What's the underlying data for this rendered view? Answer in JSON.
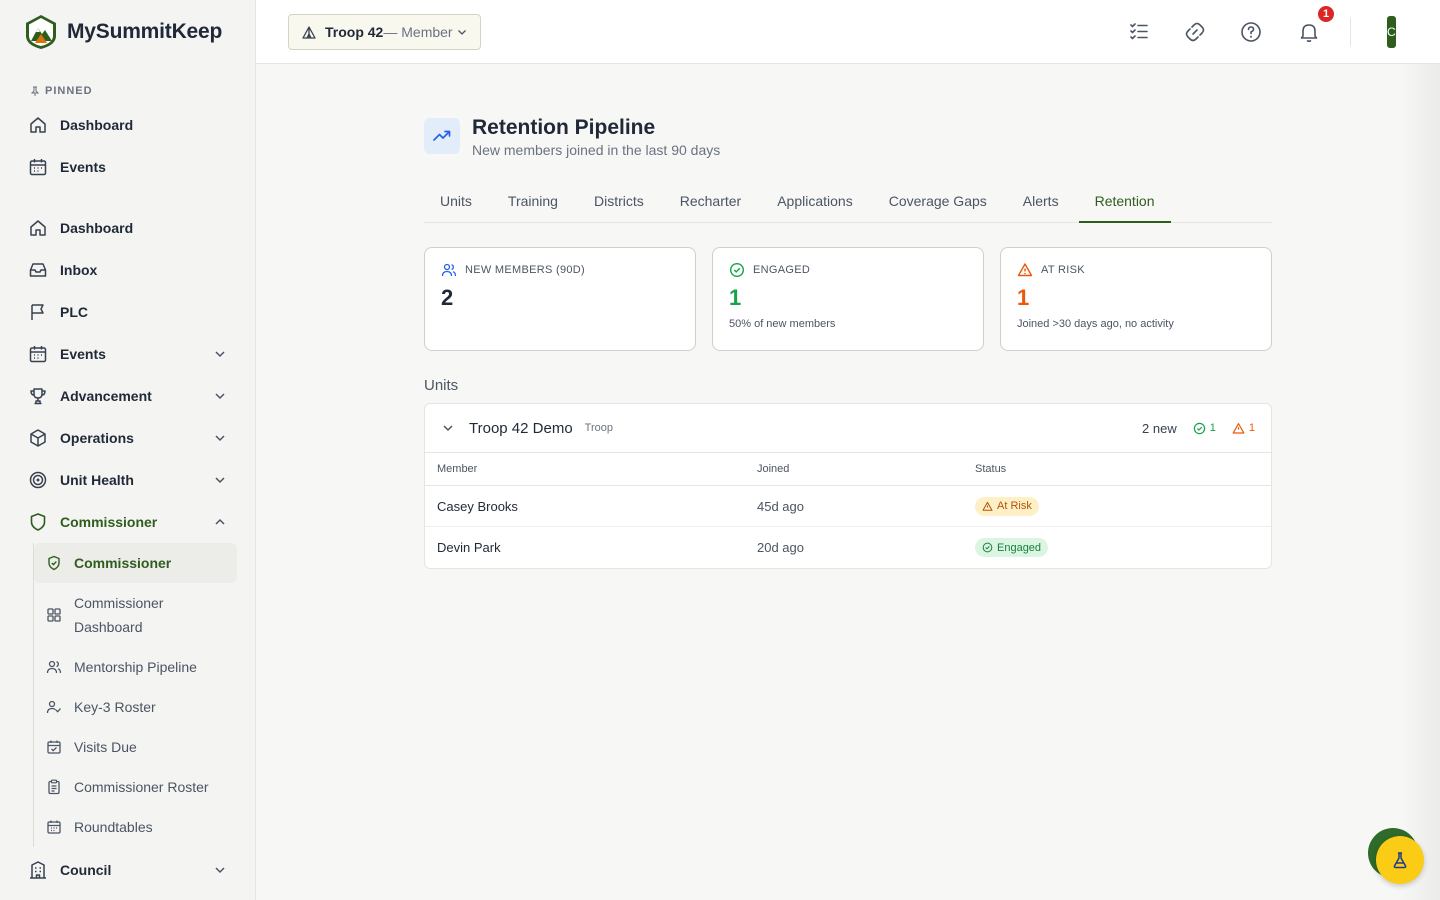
{
  "brand": {
    "name": "MySummitKeep"
  },
  "sidebar": {
    "pinned_label": "PINNED",
    "pinned": [
      {
        "label": "Dashboard",
        "icon": "home-icon"
      },
      {
        "label": "Events",
        "icon": "calendar-icon"
      }
    ],
    "items": [
      {
        "label": "Dashboard",
        "icon": "home-icon"
      },
      {
        "label": "Inbox",
        "icon": "inbox-icon"
      },
      {
        "label": "PLC",
        "icon": "flag-icon"
      },
      {
        "label": "Events",
        "icon": "calendar-icon"
      },
      {
        "label": "Advancement",
        "icon": "trophy-icon"
      },
      {
        "label": "Operations",
        "icon": "box-icon"
      },
      {
        "label": "Unit Health",
        "icon": "target-icon"
      },
      {
        "label": "Commissioner",
        "icon": "shield-icon"
      },
      {
        "label": "Council",
        "icon": "building-icon"
      }
    ],
    "commissioner_sub": [
      {
        "label": "Commissioner",
        "icon": "shield-check-icon"
      },
      {
        "label": "Commissioner Dashboard",
        "icon": "grid-icon"
      },
      {
        "label": "Mentorship Pipeline",
        "icon": "users-icon"
      },
      {
        "label": "Key-3 Roster",
        "icon": "user-check-icon"
      },
      {
        "label": "Visits Due",
        "icon": "calendar-check-icon"
      },
      {
        "label": "Commissioner Roster",
        "icon": "clipboard-icon"
      },
      {
        "label": "Roundtables",
        "icon": "calendar-icon"
      }
    ]
  },
  "topbar": {
    "unit_name": "Troop 42",
    "unit_role": " — Member",
    "notification_count": "1",
    "avatar_initial": "C"
  },
  "page": {
    "title": "Retention Pipeline",
    "subtitle": "New members joined in the last 90 days"
  },
  "tabs": [
    "Units",
    "Training",
    "Districts",
    "Recharter",
    "Applications",
    "Coverage Gaps",
    "Alerts",
    "Retention"
  ],
  "active_tab": "Retention",
  "stats": {
    "new_members": {
      "label": "NEW MEMBERS (90D)",
      "value": "2",
      "note": ""
    },
    "engaged": {
      "label": "ENGAGED",
      "value": "1",
      "note": "50% of new members"
    },
    "at_risk": {
      "label": "AT RISK",
      "value": "1",
      "note": "Joined >30 days ago, no activity"
    }
  },
  "units_label": "Units",
  "unit": {
    "name": "Troop 42 Demo",
    "type": "Troop",
    "new_count": "2 new",
    "engaged_count": "1",
    "risk_count": "1",
    "columns": [
      "Member",
      "Joined",
      "Status"
    ],
    "rows": [
      {
        "member": "Casey Brooks",
        "joined": "45d ago",
        "status": "At Risk"
      },
      {
        "member": "Devin Park",
        "joined": "20d ago",
        "status": "Engaged"
      }
    ]
  },
  "fab": {
    "icon": "flask-icon"
  },
  "colors": {
    "accent": "#2f5d1e",
    "engaged": "#16a34a",
    "risk": "#ea580c",
    "badge": "#dc2626",
    "fab": "#facc15"
  }
}
